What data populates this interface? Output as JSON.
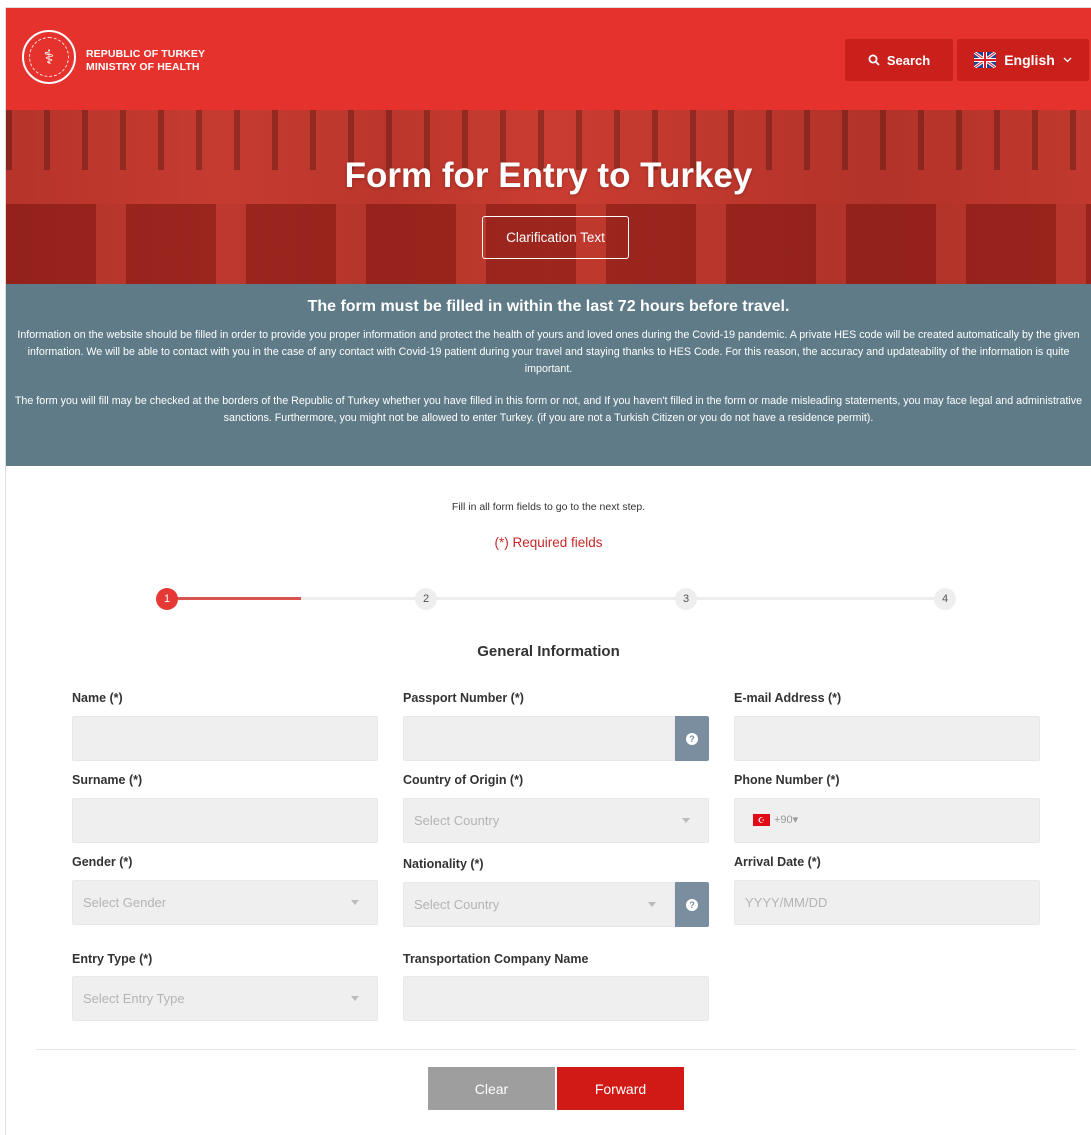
{
  "header": {
    "logo_line1": "REPUBLIC OF TURKEY",
    "logo_line2": "MINISTRY OF HEALTH",
    "search_label": "Search",
    "language_label": "English"
  },
  "hero": {
    "title": "Form for Entry to Turkey",
    "clarification_label": "Clarification Text"
  },
  "info": {
    "heading": "The form must be filled in within the last 72 hours before travel.",
    "paragraph1": "Information on the website should be filled in order to provide you proper information and protect the health of yours and loved ones during the Covid-19 pandemic. A private HES code will be created automatically by the given information. We will be able to contact with you in the case of any contact with Covid-19 patient during your travel and staying thanks to HES Code. For this reason, the accuracy and updateability of the information is quite important.",
    "paragraph2": "The form you will fill may be checked at the borders of the Republic of Turkey whether you have filled in this form or not, and If you haven't filled in the form or made misleading statements, you may face legal and administrative sanctions. Furthermore, you might not be allowed to enter Turkey. (if you are not a Turkish Citizen or you do not have a residence permit)."
  },
  "form": {
    "note": "Fill in all form fields to go to the next step.",
    "required_note": "(*) Required fields",
    "steps": [
      "1",
      "2",
      "3",
      "4"
    ],
    "current_step": 1,
    "section_title": "General Information",
    "fields": {
      "name": {
        "label": "Name (*)",
        "value": ""
      },
      "passport": {
        "label": "Passport Number (*)",
        "value": ""
      },
      "email": {
        "label": "E-mail Address (*)",
        "value": ""
      },
      "surname": {
        "label": "Surname (*)",
        "value": ""
      },
      "country_origin": {
        "label": "Country of Origin (*)",
        "placeholder": "Select Country"
      },
      "phone": {
        "label": "Phone Number (*)",
        "dial_code": "+90"
      },
      "gender": {
        "label": "Gender (*)",
        "placeholder": "Select Gender"
      },
      "nationality": {
        "label": "Nationality (*)",
        "placeholder": "Select Country"
      },
      "arrival_date": {
        "label": "Arrival Date (*)",
        "placeholder": "YYYY/MM/DD"
      },
      "entry_type": {
        "label": "Entry Type (*)",
        "placeholder": "Select Entry Type"
      },
      "transport_company": {
        "label": "Transportation Company Name",
        "value": ""
      }
    },
    "clear_label": "Clear",
    "forward_label": "Forward"
  },
  "colors": {
    "brand_red": "#e5322d",
    "info_band": "#5f7b87",
    "help_button": "#7a8ea0",
    "forward_button": "#d11a16",
    "clear_button": "#9e9e9e"
  }
}
